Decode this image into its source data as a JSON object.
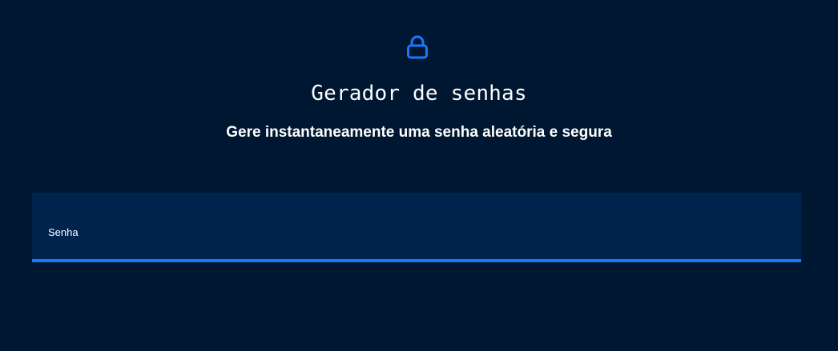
{
  "header": {
    "icon": "lock-icon",
    "title": "Gerador de senhas",
    "subtitle": "Gere instantaneamente uma senha aleatória e segura"
  },
  "password_field": {
    "label": "Senha",
    "value": ""
  },
  "colors": {
    "background": "#001731",
    "field_background": "#00234e",
    "accent": "#1a78ff",
    "text": "#ffffff"
  }
}
